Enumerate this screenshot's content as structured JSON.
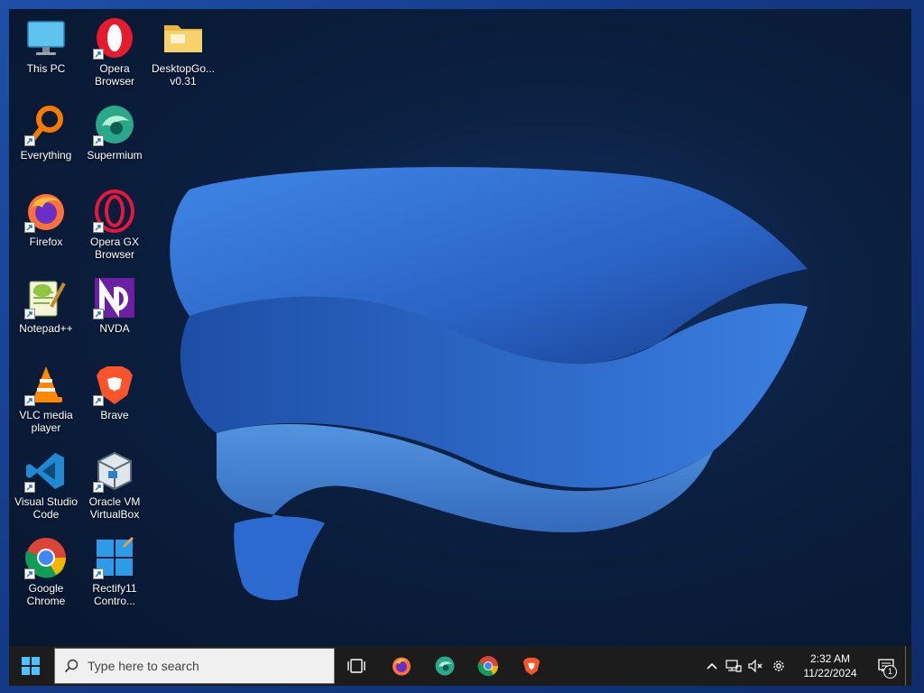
{
  "desktop": {
    "icons": [
      {
        "label": "This PC",
        "icon": "monitor-icon",
        "shortcut": false
      },
      {
        "label": "Opera Browser",
        "icon": "opera-icon",
        "shortcut": true
      },
      {
        "label": "DesktopGo... v0.31",
        "icon": "folder-icon",
        "shortcut": false
      },
      {
        "label": "Everything",
        "icon": "everything-magnifier-icon",
        "shortcut": true
      },
      {
        "label": "Supermium",
        "icon": "supermium-icon",
        "shortcut": true
      },
      {
        "label": "Firefox",
        "icon": "firefox-icon",
        "shortcut": true
      },
      {
        "label": "Opera GX Browser",
        "icon": "opera-gx-icon",
        "shortcut": true
      },
      {
        "label": "Notepad++",
        "icon": "notepad-plus-plus-icon",
        "shortcut": true
      },
      {
        "label": "NVDA",
        "icon": "nvda-icon",
        "shortcut": true
      },
      {
        "label": "VLC media player",
        "icon": "vlc-cone-icon",
        "shortcut": true
      },
      {
        "label": "Brave",
        "icon": "brave-lion-icon",
        "shortcut": true
      },
      {
        "label": "Visual Studio Code",
        "icon": "vscode-icon",
        "shortcut": true
      },
      {
        "label": "Oracle VM VirtualBox",
        "icon": "virtualbox-cube-icon",
        "shortcut": true
      },
      {
        "label": "Google Chrome",
        "icon": "chrome-icon",
        "shortcut": true
      },
      {
        "label": "Rectify11 Contro...",
        "icon": "rectify11-icon",
        "shortcut": true
      }
    ]
  },
  "taskbar": {
    "search_placeholder": "Type here to search",
    "pinned": [
      "firefox-icon",
      "supermium-icon",
      "chrome-icon",
      "brave-lion-icon"
    ],
    "clock_time": "2:32 AM",
    "clock_date": "11/22/2024",
    "notification_count": "1"
  },
  "colors": {
    "taskbar_bg": "#1c1c1c",
    "wallpaper_bloom": "#2f6bd0",
    "desktop_bg": "#0b1f3f"
  }
}
